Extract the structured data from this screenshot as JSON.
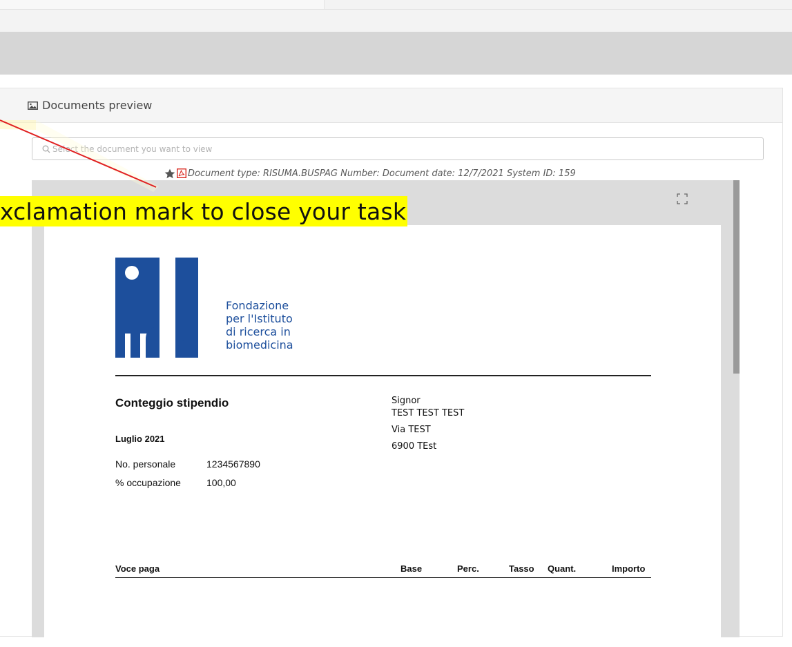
{
  "panel": {
    "title": "Documents preview",
    "icon": "image-icon"
  },
  "document_select": {
    "placeholder": "Select the document you want to view",
    "icon": "search-icon"
  },
  "document_info": {
    "text": "Document type: RISUMA.BUSPAG Number: Document date: 12/7/2021 System ID: 159",
    "favorite_icon": "star-icon",
    "file_icon": "pdf-icon"
  },
  "annotation": {
    "text": "xclamation mark to close your task",
    "color": "#ffff00",
    "arrow_color": "#e02020"
  },
  "document": {
    "logo_text": [
      "Fondazione",
      "per l'Istituto",
      "di ricerca in",
      "biomedicina"
    ],
    "brand_color": "#1d4f9c",
    "title": "Conteggio stipendio",
    "month": "Luglio 2021",
    "fields": [
      {
        "label": "No. personale",
        "value": "1234567890"
      },
      {
        "label": "% occupazione",
        "value": "100,00"
      }
    ],
    "address": {
      "salutation": "Signor",
      "name": "TEST TEST TEST",
      "street": "Via TEST",
      "city": "6900 TEst"
    },
    "table_headers": {
      "item": "Voce paga",
      "base": "Base",
      "perc": "Perc.",
      "rate": "Tasso",
      "qty": "Quant.",
      "amount": "Importo"
    }
  }
}
